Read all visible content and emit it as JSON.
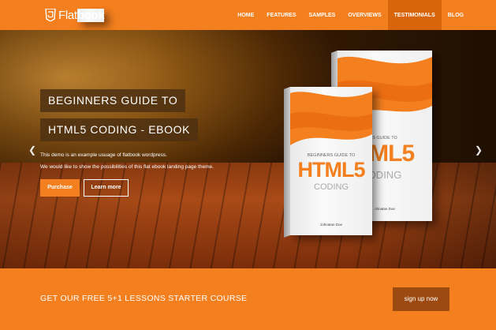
{
  "brand": {
    "name_part1": "Flat",
    "name_part2": "book",
    "icon": "html5-shield-icon"
  },
  "nav": {
    "items": [
      {
        "label": "HOME"
      },
      {
        "label": "FEATURES"
      },
      {
        "label": "SAMPLES"
      },
      {
        "label": "OVERVIEWS"
      },
      {
        "label": "TESTIMONIALS",
        "active": true
      },
      {
        "label": "BLOG"
      }
    ]
  },
  "hero": {
    "title_line1": "BEGINNERS GUIDE TO",
    "title_line2": "HTML5 CODING - EBOOK",
    "desc_line1": "This demo is an example usuage of flatbook wordpress.",
    "desc_line2": "We would like to show the possibilities of this flat ebook landing page theme.",
    "purchase_label": "Purchase",
    "learn_more_label": "Learn more",
    "prev_icon": "chevron-left-icon",
    "next_icon": "chevron-right-icon"
  },
  "book_front": {
    "subtitle": "BEGINNERS GUIDE TO",
    "html": "HTML5",
    "coding": "CODING",
    "author": "Johnatan Doe"
  },
  "book_back": {
    "subtitle": "S GUIDE TO",
    "html": "TML5",
    "coding": "ODING",
    "author": "ohnatan Doe"
  },
  "cta": {
    "text": "GET OUR FREE 5+1 LESSONS STARTER COURSE",
    "button_label": "sign up now"
  },
  "colors": {
    "accent": "#f47f1e",
    "accent_dark": "#d9650b",
    "cta_button": "#9c4a0f"
  }
}
